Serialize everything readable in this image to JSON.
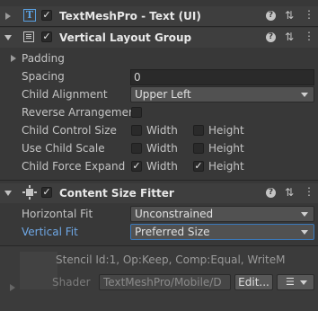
{
  "components": {
    "textmeshpro": {
      "title": "TextMeshPro - Text (UI)",
      "icon": "T"
    },
    "vertical_layout": {
      "title": "Vertical Layout Group",
      "padding_label": "Padding",
      "spacing_label": "Spacing",
      "spacing_value": "0",
      "child_alignment_label": "Child Alignment",
      "child_alignment_value": "Upper Left",
      "reverse_label": "Reverse Arrangement",
      "control_size_label": "Child Control Size",
      "use_scale_label": "Use Child Scale",
      "force_expand_label": "Child Force Expand",
      "width_label": "Width",
      "height_label": "Height",
      "control_size": {
        "width": false,
        "height": false
      },
      "use_scale": {
        "width": false,
        "height": false
      },
      "force_expand": {
        "width": true,
        "height": true
      }
    },
    "content_size_fitter": {
      "title": "Content Size Fitter",
      "horizontal_label": "Horizontal Fit",
      "horizontal_value": "Unconstrained",
      "vertical_label": "Vertical Fit",
      "vertical_value": "Preferred Size"
    }
  },
  "material": {
    "stencil_text": "Stencil Id:1, Op:Keep, Comp:Equal, WriteM",
    "shader_label": "Shader",
    "shader_value": "TextMeshPro/Mobile/D",
    "edit_label": "Edit..."
  },
  "check_glyph": "✓",
  "colors": {
    "accent_label": "#6fa8e6",
    "focus_border": "#3a79bb"
  }
}
